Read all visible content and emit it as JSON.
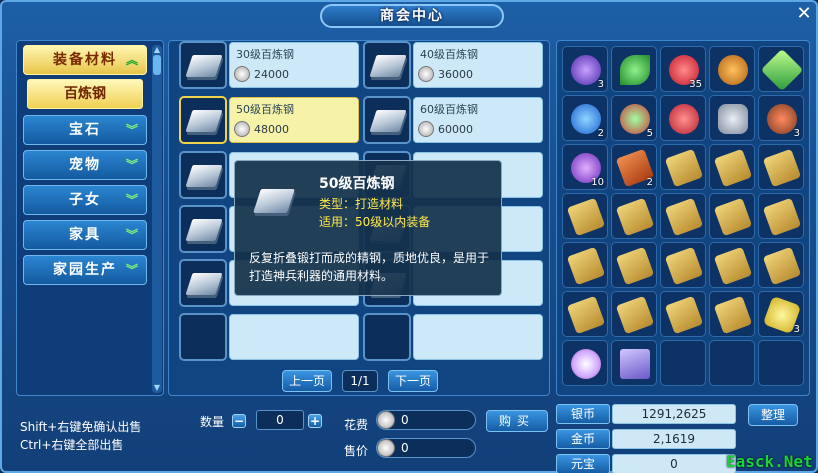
{
  "window": {
    "title": "商会中心",
    "close": "✕"
  },
  "categories": [
    {
      "label": "装备材料",
      "active": true
    },
    {
      "label": "宝石"
    },
    {
      "label": "宠物"
    },
    {
      "label": "子女"
    },
    {
      "label": "家具"
    },
    {
      "label": "家园生产"
    }
  ],
  "subcategory": "百炼钢",
  "items": [
    {
      "name": "30级百炼钢",
      "price": "24000"
    },
    {
      "name": "40级百炼钢",
      "price": "36000"
    },
    {
      "name": "50级百炼钢",
      "price": "48000",
      "selected": true
    },
    {
      "name": "60级百炼钢",
      "price": "60000"
    }
  ],
  "pager": {
    "prev": "上一页",
    "info": "1/1",
    "next": "下一页"
  },
  "tooltip": {
    "name": "50级百炼钢",
    "type": "类型：打造材料",
    "use": "适用：50级以内装备",
    "desc": "反复折叠锻打而成的精钢，质地优良，是用于打造神兵利器的通用材料。"
  },
  "inventory": [
    {
      "icon": "crystal-icon",
      "count": "3"
    },
    {
      "icon": "leaf-icon",
      "count": ""
    },
    {
      "icon": "red-ball-icon",
      "count": "35"
    },
    {
      "icon": "ring-icon",
      "count": ""
    },
    {
      "icon": "sword-icon",
      "count": ""
    },
    {
      "icon": "flame-icon",
      "count": "2"
    },
    {
      "icon": "swirl-icon",
      "count": "5"
    },
    {
      "icon": "red-drop-icon",
      "count": ""
    },
    {
      "icon": "stone-icon",
      "count": ""
    },
    {
      "icon": "spike-icon",
      "count": "3"
    },
    {
      "icon": "orb-icon",
      "count": "10"
    },
    {
      "icon": "red-scroll-icon",
      "count": "2"
    },
    {
      "icon": "scroll-icon",
      "count": ""
    },
    {
      "icon": "scroll-icon",
      "count": ""
    },
    {
      "icon": "scroll-icon",
      "count": ""
    },
    {
      "icon": "scroll-icon",
      "count": ""
    },
    {
      "icon": "scroll-icon",
      "count": ""
    },
    {
      "icon": "scroll-icon",
      "count": ""
    },
    {
      "icon": "scroll-icon",
      "count": ""
    },
    {
      "icon": "scroll-icon",
      "count": ""
    },
    {
      "icon": "scroll-icon",
      "count": ""
    },
    {
      "icon": "scroll-icon",
      "count": ""
    },
    {
      "icon": "scroll-icon",
      "count": ""
    },
    {
      "icon": "scroll-icon",
      "count": ""
    },
    {
      "icon": "scroll-icon",
      "count": ""
    },
    {
      "icon": "scroll-icon",
      "count": ""
    },
    {
      "icon": "scroll-icon",
      "count": ""
    },
    {
      "icon": "scroll-icon",
      "count": ""
    },
    {
      "icon": "scroll-icon",
      "count": ""
    },
    {
      "icon": "gem-icon",
      "count": "3"
    },
    {
      "icon": "pearl-icon",
      "count": ""
    },
    {
      "icon": "paper-icon",
      "count": ""
    },
    {
      "icon": "",
      "count": ""
    },
    {
      "icon": "",
      "count": ""
    },
    {
      "icon": "",
      "count": ""
    }
  ],
  "hints": {
    "line1": "Shift+右键免确认出售",
    "line2": "Ctrl+右键全部出售"
  },
  "trade": {
    "qty_label": "数量",
    "qty_minus": "−",
    "qty_value": "0",
    "qty_plus": "+",
    "cost_label": "花费",
    "cost_value": "0",
    "sell_label": "售价",
    "sell_value": "0",
    "buy": "购买"
  },
  "currency": {
    "silver_label": "银币",
    "silver_value": "1291,2625",
    "gold_label": "金币",
    "gold_value": "2,1619",
    "yuanbao_label": "元宝",
    "yuanbao_value": "0"
  },
  "sort_label": "整理",
  "watermark": "Easck.Net"
}
